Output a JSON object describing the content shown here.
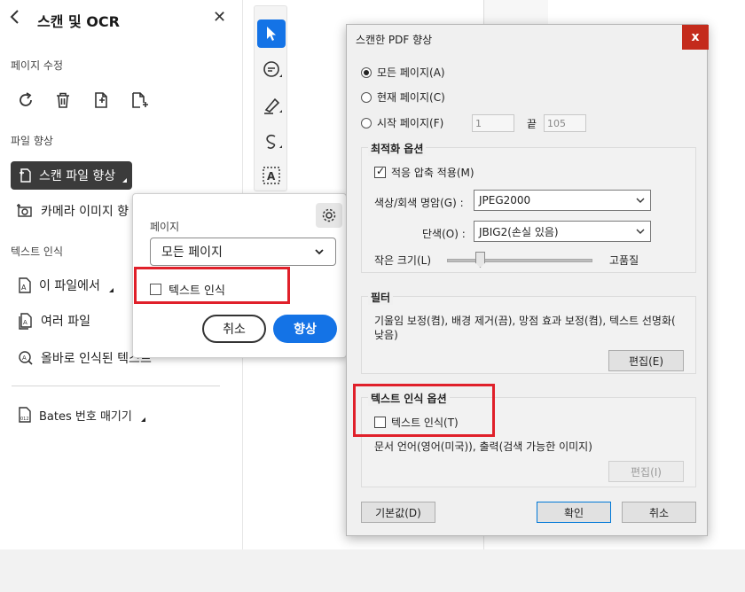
{
  "panel": {
    "title": "스캔 및 OCR",
    "sections": {
      "page_edit": "페이지 수정",
      "file_enhance": "파일 향상",
      "text_recognition": "텍스트 인식"
    },
    "items": {
      "enhance_scanned": "스캔 파일 향상",
      "enhance_camera": "카메라 이미지 향",
      "in_this_file": "이 파일에서",
      "multiple_files": "여러 파일",
      "correct_text": "올바로 인식된 텍스트",
      "bates": "Bates 번호 매기기"
    }
  },
  "popup": {
    "page_label": "페이지",
    "page_value": "모든 페이지",
    "text_recognition": "텍스트 인식",
    "cancel": "취소",
    "enhance": "향상"
  },
  "dialog": {
    "title": "스캔한 PDF 향상",
    "close": "x",
    "radio_all": "모든 페이지(A)",
    "radio_current": "현재 페이지(C)",
    "radio_start": "시작 페이지(F)",
    "start_value": "1",
    "end_label": "끝",
    "end_value": "105",
    "optimization": {
      "title": "최적화 옵션",
      "adaptive": "적응 압축 적용(M)",
      "color_label": "색상/회색 명암(G) :",
      "color_value": "JPEG2000",
      "mono_label": "단색(O) :",
      "mono_value": "JBIG2(손실 있음)",
      "small_size": "작은 크기(L)",
      "high_quality": "고품질",
      "quality_level": 0.2
    },
    "filter": {
      "title": "필터",
      "desc_line1": "기울임 보정(켬), 배경 제거(끔), 망점 효과 보정(켬), 텍스트 선명화(",
      "desc_line2": "낮음)",
      "edit": "편집(E)"
    },
    "text_options": {
      "title": "텍스트 인식 옵션",
      "checkbox": "텍스트 인식(T)",
      "desc": "문서 언어(영어(미국)), 출력(검색 가능한 이미지)",
      "edit": "편집(I)"
    },
    "buttons": {
      "defaults": "기본값(D)",
      "ok": "확인",
      "cancel": "취소"
    }
  },
  "colors": {
    "accent": "#1473e6",
    "highlight_red": "#e0202a",
    "close_red": "#c42b1c"
  }
}
